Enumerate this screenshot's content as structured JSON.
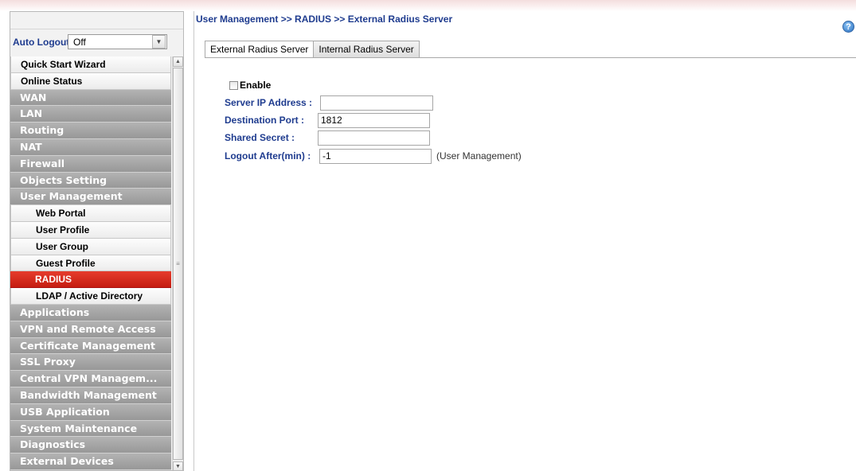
{
  "breadcrumb": "User Management >> RADIUS >> External Radius Server",
  "auto_logout": {
    "label": "Auto Logout :",
    "value": "Off"
  },
  "menu": [
    {
      "label": "Quick Start Wizard",
      "style": "light"
    },
    {
      "label": "Online Status",
      "style": "light"
    },
    {
      "label": "WAN",
      "style": "dark"
    },
    {
      "label": "LAN",
      "style": "dark"
    },
    {
      "label": "Routing",
      "style": "dark"
    },
    {
      "label": "NAT",
      "style": "dark"
    },
    {
      "label": "Firewall",
      "style": "dark"
    },
    {
      "label": "Objects Setting",
      "style": "dark"
    },
    {
      "label": "User Management",
      "style": "dark"
    },
    {
      "label": "Web Portal",
      "style": "sub"
    },
    {
      "label": "User Profile",
      "style": "sub"
    },
    {
      "label": "User Group",
      "style": "sub"
    },
    {
      "label": "Guest Profile",
      "style": "sub"
    },
    {
      "label": "RADIUS",
      "style": "active"
    },
    {
      "label": "LDAP / Active Directory",
      "style": "sub"
    },
    {
      "label": "Applications",
      "style": "dark"
    },
    {
      "label": "VPN and Remote Access",
      "style": "dark"
    },
    {
      "label": "Certificate Management",
      "style": "dark"
    },
    {
      "label": "SSL Proxy",
      "style": "dark"
    },
    {
      "label": "Central VPN Managem...",
      "style": "dark"
    },
    {
      "label": "Bandwidth Management",
      "style": "dark"
    },
    {
      "label": "USB Application",
      "style": "dark"
    },
    {
      "label": "System Maintenance",
      "style": "dark"
    },
    {
      "label": "Diagnostics",
      "style": "dark"
    },
    {
      "label": "External Devices",
      "style": "dark"
    }
  ],
  "tabs": [
    {
      "label": "External Radius Server",
      "active": true
    },
    {
      "label": "Internal Radius Server",
      "active": false
    }
  ],
  "form": {
    "enable_label": "Enable",
    "enable_checked": false,
    "server_ip_label": "Server IP Address :",
    "server_ip_value": "",
    "dest_port_label": "Destination Port :",
    "dest_port_value": "1812",
    "shared_secret_label": "Shared Secret :",
    "shared_secret_value": "",
    "logout_after_label": "Logout After(min) :",
    "logout_after_value": "-1",
    "logout_after_hint": "(User Management)"
  },
  "icons": {
    "help": "help-icon",
    "select_arrow": "chevron-down-icon",
    "scroll_up": "scroll-up-icon",
    "scroll_down": "scroll-down-icon"
  },
  "colors": {
    "active_menu": "#d42a1c",
    "label_blue": "#1f3c8f",
    "dark_menu": "#a6a6a6"
  }
}
